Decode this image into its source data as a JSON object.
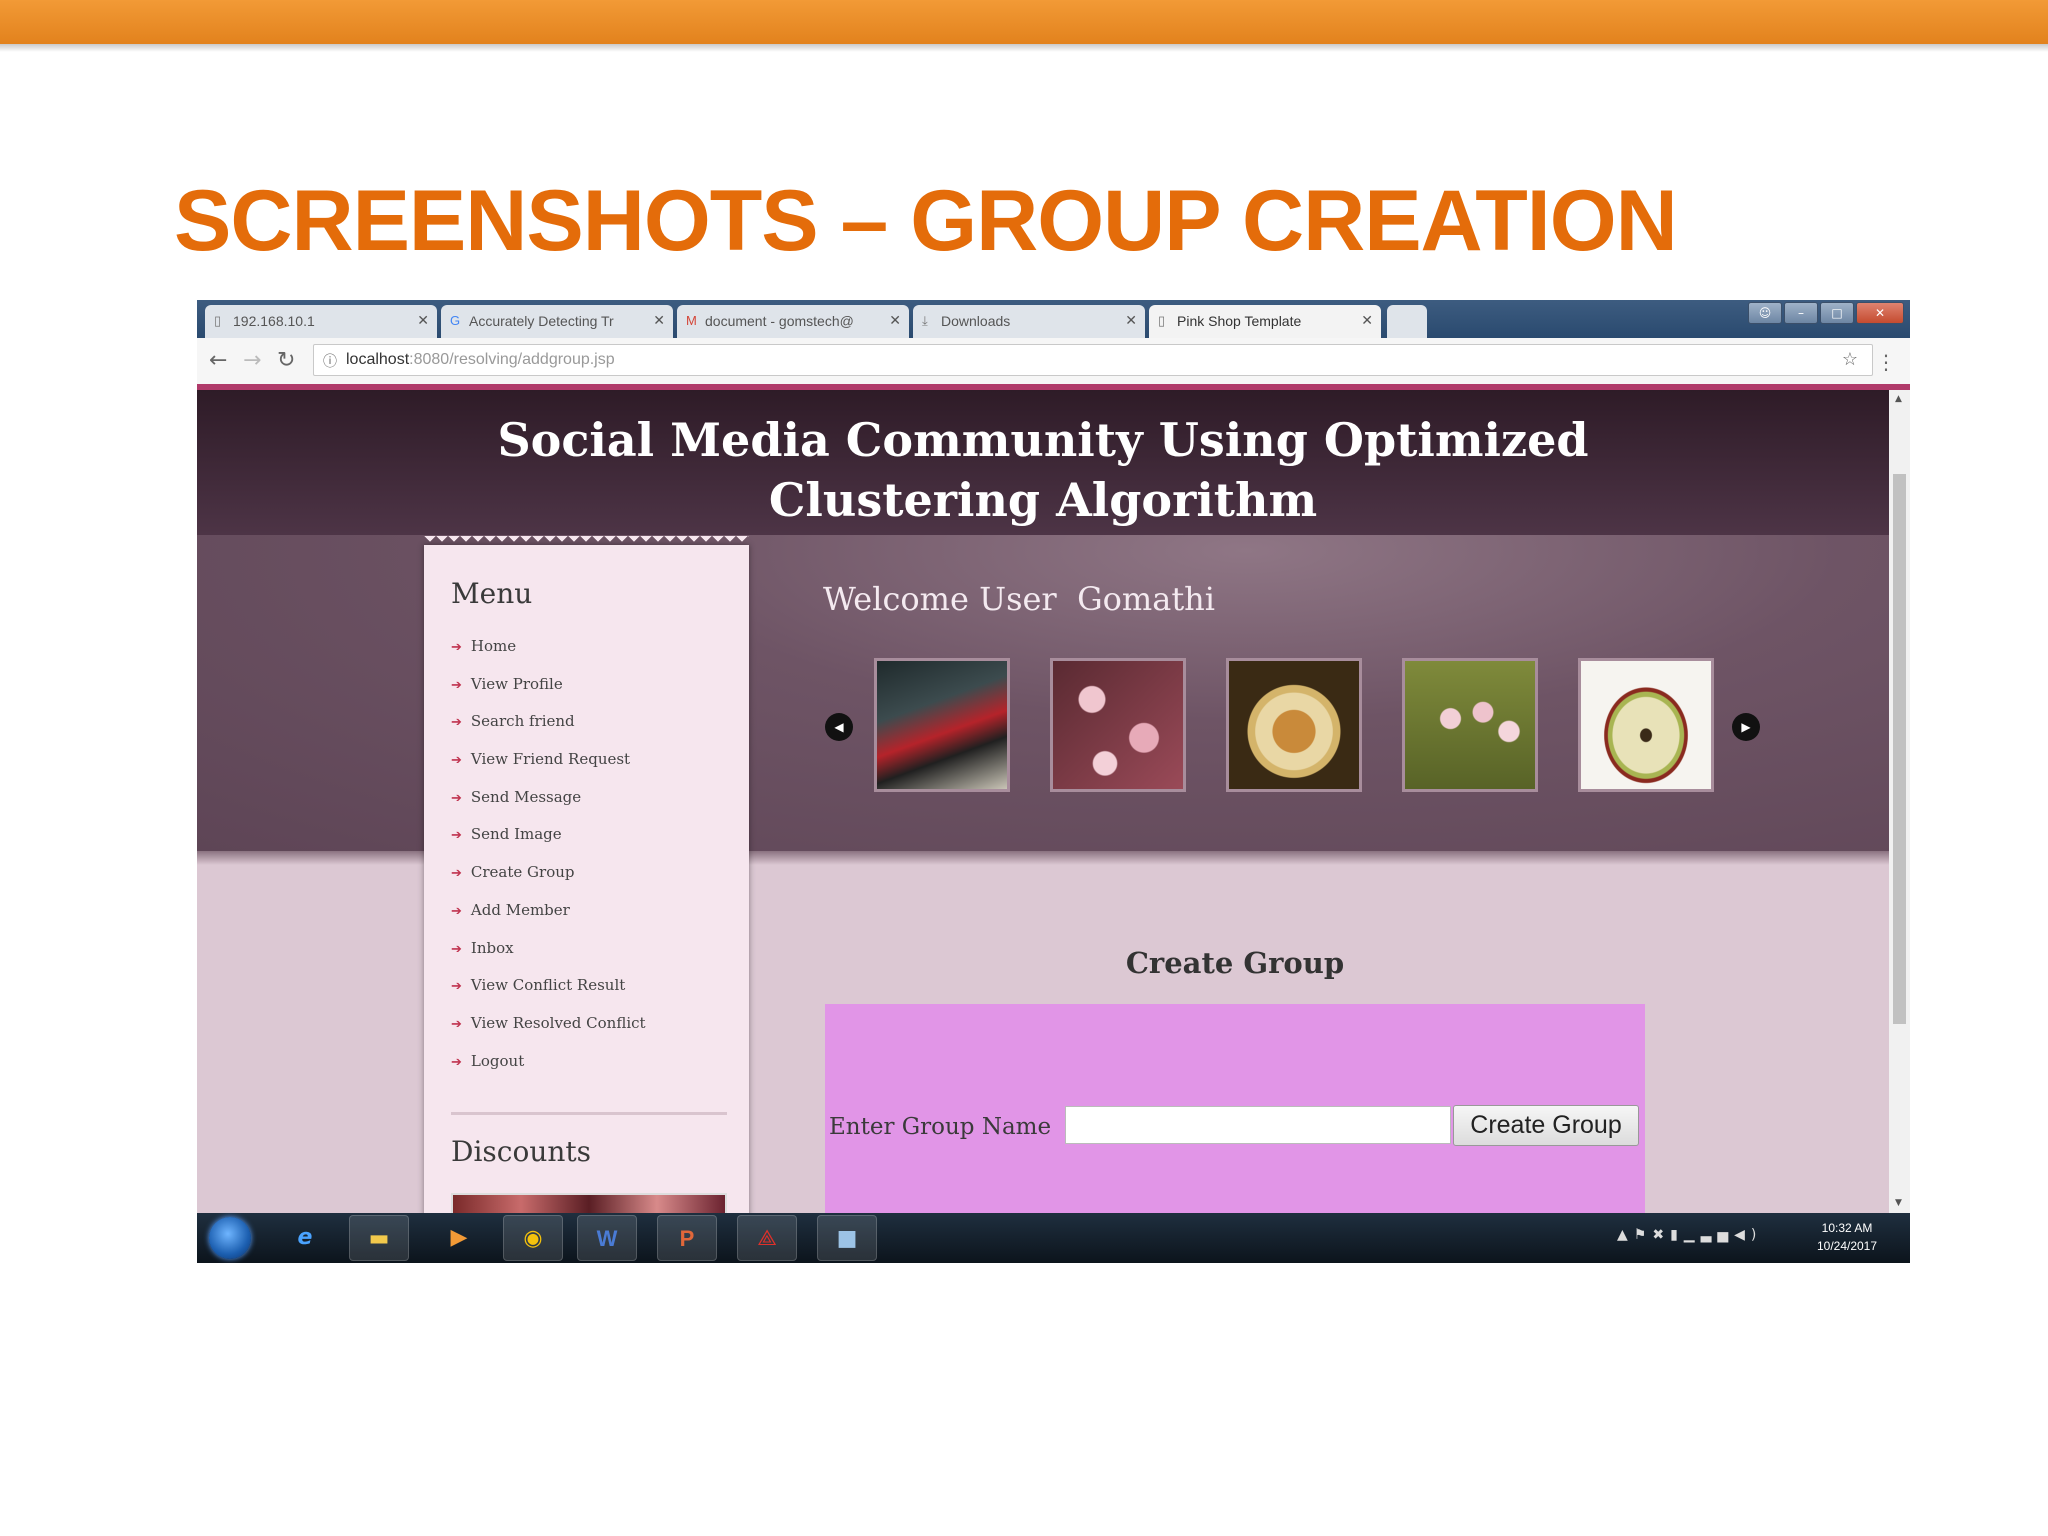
{
  "slide": {
    "title": "SCREENSHOTS – GROUP CREATION"
  },
  "browser": {
    "tabs": [
      {
        "label": "192.168.10.1",
        "icon": "page-icon"
      },
      {
        "label": "Accurately Detecting Tr",
        "icon": "google-icon"
      },
      {
        "label": "document - gomstech@",
        "icon": "gmail-icon"
      },
      {
        "label": "Downloads",
        "icon": "download-icon"
      },
      {
        "label": "Pink Shop Template",
        "icon": "page-icon"
      }
    ],
    "url_host": "localhost",
    "url_path": ":8080/resolving/addgroup.jsp"
  },
  "site": {
    "title_line1": "Social Media Community Using Optimized",
    "title_line2": "Clustering Algorithm",
    "welcome": "Welcome User  Gomathi",
    "menu_heading": "Menu",
    "menu_items": [
      "Home",
      "View Profile",
      "Search friend",
      "View Friend Request",
      "Send Message",
      "Send Image",
      "Create Group",
      "Add Member",
      "Inbox",
      "View Conflict Result",
      "View Resolved Conflict",
      "Logout"
    ],
    "discounts_heading": "Discounts",
    "gallery": [
      "scooter-photo",
      "cherry-blossom-photo",
      "coffee-cup-photo",
      "orchid-photo",
      "apple-photo"
    ]
  },
  "form": {
    "heading": "Create Group",
    "label": "Enter Group Name",
    "input_value": "",
    "button": "Create Group"
  },
  "taskbar": {
    "time": "10:32 AM",
    "date": "10/24/2017"
  },
  "colors": {
    "accent_orange": "#e46c0a",
    "header_plum": "#3a2533",
    "form_pink": "#e195e7",
    "menu_arrow": "#c0334f"
  }
}
